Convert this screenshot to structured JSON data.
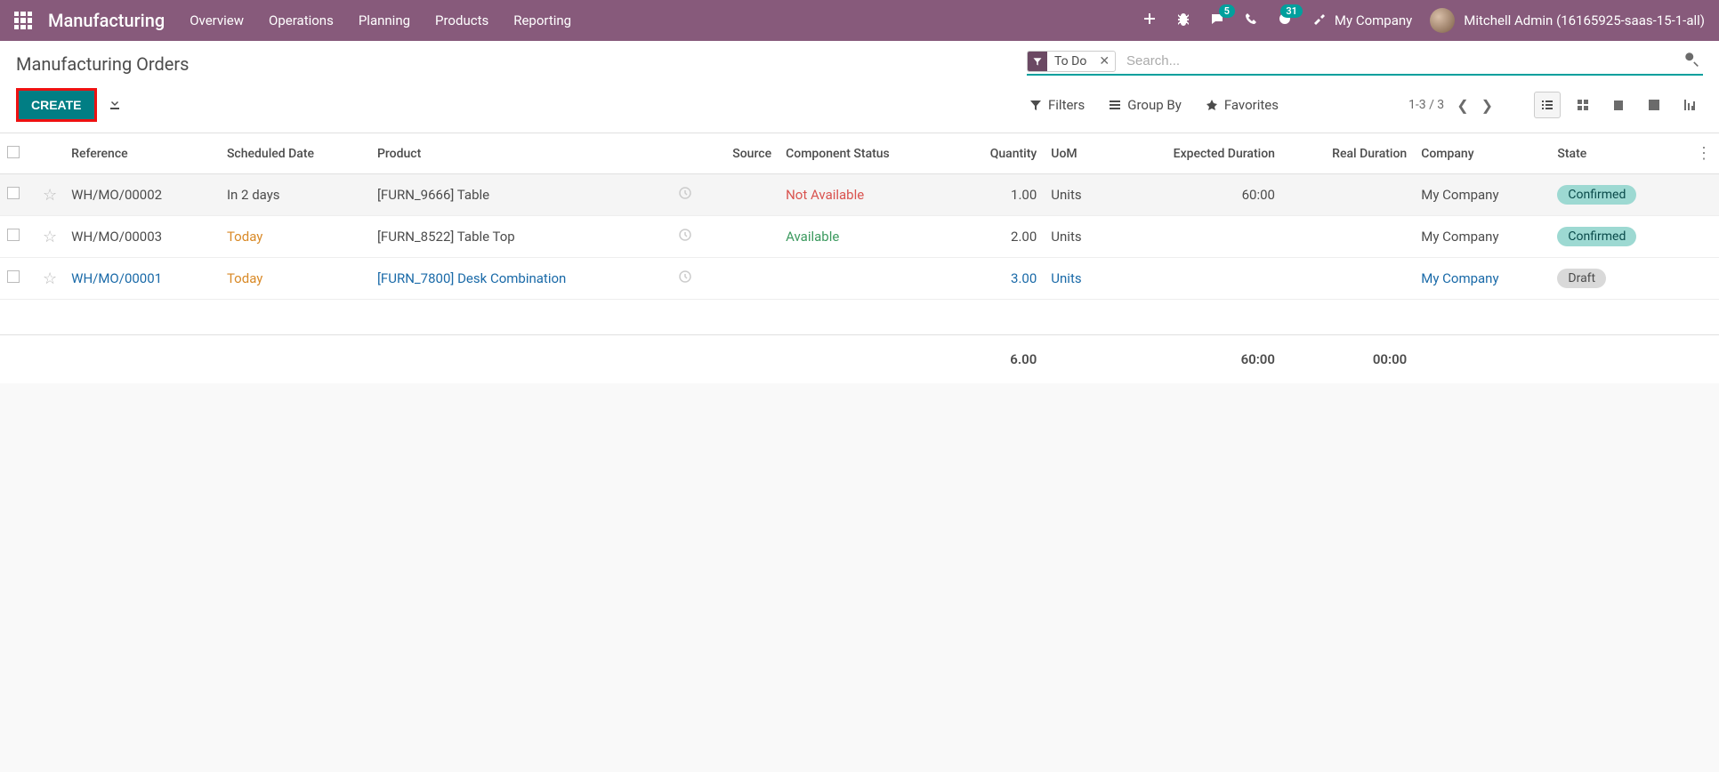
{
  "topbar": {
    "app_name": "Manufacturing",
    "nav": [
      "Overview",
      "Operations",
      "Planning",
      "Products",
      "Reporting"
    ],
    "messages_badge": "5",
    "activities_badge": "31",
    "company": "My Company",
    "user": "Mitchell Admin (16165925-saas-15-1-all)"
  },
  "control_panel": {
    "breadcrumb": "Manufacturing Orders",
    "filter_chip": "To Do",
    "search_placeholder": "Search...",
    "create_label": "CREATE",
    "filters_label": "Filters",
    "groupby_label": "Group By",
    "favorites_label": "Favorites",
    "pager": "1-3 / 3"
  },
  "table": {
    "headers": {
      "reference": "Reference",
      "scheduled": "Scheduled Date",
      "product": "Product",
      "source": "Source",
      "component_status": "Component Status",
      "quantity": "Quantity",
      "uom": "UoM",
      "expected": "Expected Duration",
      "real": "Real Duration",
      "company": "Company",
      "state": "State"
    },
    "rows": [
      {
        "reference": "WH/MO/00002",
        "scheduled": "In 2 days",
        "scheduled_class": "",
        "product": "[FURN_9666] Table",
        "component_status": "Not Available",
        "component_class": "text-danger",
        "quantity": "1.00",
        "uom": "Units",
        "expected": "60:00",
        "real": "",
        "company": "My Company",
        "state": "Confirmed",
        "state_class": "state-confirmed",
        "link": false
      },
      {
        "reference": "WH/MO/00003",
        "scheduled": "Today",
        "scheduled_class": "text-warning",
        "product": "[FURN_8522] Table Top",
        "component_status": "Available",
        "component_class": "text-success",
        "quantity": "2.00",
        "uom": "Units",
        "expected": "",
        "real": "",
        "company": "My Company",
        "state": "Confirmed",
        "state_class": "state-confirmed",
        "link": false
      },
      {
        "reference": "WH/MO/00001",
        "scheduled": "Today",
        "scheduled_class": "text-warning",
        "product": "[FURN_7800] Desk Combination",
        "component_status": "",
        "component_class": "",
        "quantity": "3.00",
        "uom": "Units",
        "expected": "",
        "real": "",
        "company": "My Company",
        "state": "Draft",
        "state_class": "state-draft",
        "link": true
      }
    ],
    "totals": {
      "quantity": "6.00",
      "expected": "60:00",
      "real": "00:00"
    }
  }
}
